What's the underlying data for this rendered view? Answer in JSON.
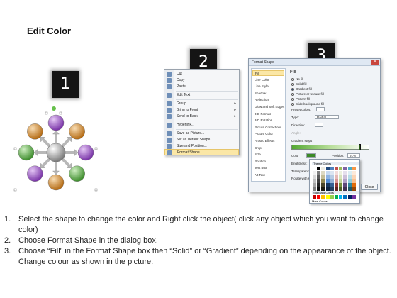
{
  "page": {
    "title": "Edit Color"
  },
  "steps": [
    "1",
    "2",
    "3"
  ],
  "context_menu": {
    "items": [
      {
        "label": "Cut",
        "icon": "scissors-icon"
      },
      {
        "label": "Copy",
        "icon": "copy-icon"
      },
      {
        "label": "Paste",
        "icon": "paste-icon"
      },
      {
        "label": "Edit Text",
        "icon": "text-icon"
      },
      {
        "label": "Group",
        "icon": "group-icon",
        "submenu": true
      },
      {
        "label": "Bring to Front",
        "icon": "bring-front-icon",
        "submenu": true
      },
      {
        "label": "Send to Back",
        "icon": "send-back-icon",
        "submenu": true
      },
      {
        "label": "Hyperlink...",
        "icon": "hyperlink-icon"
      },
      {
        "label": "Save as Picture...",
        "icon": "picture-icon"
      },
      {
        "label": "Set as Default Shape",
        "icon": "default-shape-icon"
      },
      {
        "label": "Size and Position...",
        "icon": "size-icon"
      },
      {
        "label": "Format Shape...",
        "icon": "format-shape-icon",
        "highlighted": true
      }
    ]
  },
  "format_dialog": {
    "title": "Format Shape",
    "close_symbol": "✕",
    "categories": [
      "Fill",
      "Line Color",
      "Line Style",
      "Shadow",
      "Reflection",
      "Glow and Soft Edges",
      "3-D Format",
      "3-D Rotation",
      "Picture Corrections",
      "Picture Color",
      "Artistic Effects",
      "Crop",
      "Size",
      "Position",
      "Text Box",
      "Alt Text"
    ],
    "selected_category": "Fill",
    "fill_heading": "Fill",
    "fill_options": [
      "No fill",
      "Solid fill",
      "Gradient fill",
      "Picture or texture fill",
      "Pattern fill",
      "Slide background fill"
    ],
    "selected_fill": "Gradient fill",
    "fields": {
      "preset_label": "Preset colors:",
      "type_label": "Type:",
      "type_value": "Radial",
      "direction_label": "Direction:",
      "angle_label": "Angle:",
      "stops_label": "Gradient stops",
      "color_label": "Color",
      "position_label": "Position:",
      "position_value": "91%",
      "brightness_label": "Brightness:",
      "transparency_label": "Transparency:",
      "rotate_label": "Rotate with shape"
    },
    "close_button": "Close",
    "gradient_colors": [
      "#54a832",
      "#b8de9a",
      "#ffffff"
    ]
  },
  "color_palette": {
    "theme_heading": "Theme Colors",
    "standard_heading": "Standard Colors",
    "more_label": "More Colors...",
    "theme_colors": [
      "#ffffff",
      "#000000",
      "#eeece1",
      "#1f497d",
      "#4f81bd",
      "#c0504d",
      "#9bbb59",
      "#8064a2",
      "#4bacc6",
      "#f79646",
      "#f2f2f2",
      "#7f7f7f",
      "#ddd9c3",
      "#c6d9f0",
      "#dbe5f1",
      "#f2dcdb",
      "#ebf1dd",
      "#e5e0ec",
      "#dbeef3",
      "#fdeada",
      "#d8d8d8",
      "#595959",
      "#c4bd97",
      "#8db3e2",
      "#b8cce4",
      "#e5b9b7",
      "#d7e3bc",
      "#ccc1d9",
      "#b7dde8",
      "#fbd5b5",
      "#bfbfbf",
      "#3f3f3f",
      "#938953",
      "#548dd4",
      "#95b3d7",
      "#d99694",
      "#c3d69b",
      "#b2a2c7",
      "#92cddc",
      "#fac08f",
      "#a5a5a5",
      "#262626",
      "#494429",
      "#17365d",
      "#366092",
      "#953734",
      "#76923c",
      "#5f497a",
      "#31859b",
      "#e36c09",
      "#7f7f7f",
      "#0c0c0c",
      "#1d1b10",
      "#0f243e",
      "#244061",
      "#632423",
      "#4f6128",
      "#3f3151",
      "#205867",
      "#974806"
    ],
    "standard_colors": [
      "#c00000",
      "#ff0000",
      "#ffc000",
      "#ffff00",
      "#92d050",
      "#00b050",
      "#00b0f0",
      "#0070c0",
      "#002060",
      "#7030a0"
    ]
  },
  "diagram": {
    "shapes": [
      "purple",
      "orange",
      "purple",
      "green",
      "orange",
      "purple",
      "green",
      "orange"
    ],
    "colors": {
      "purple": "#9b4fc8",
      "orange": "#d98c2c",
      "green": "#5fb64a",
      "center": "#a9a9a9",
      "arrow": "#b8b8b8"
    }
  },
  "instructions": [
    {
      "num": "1.",
      "text": "Select the shape to change the color and Right click the object( click any object which you want to change color)"
    },
    {
      "num": "2.",
      "text": "Choose Format Shape in the dialog box."
    },
    {
      "num": "3.",
      "text": "Choose “Fill” in the Format Shape box then “Solid” or “Gradient” depending on the appearance of the object. Change colour as shown in the picture."
    }
  ]
}
